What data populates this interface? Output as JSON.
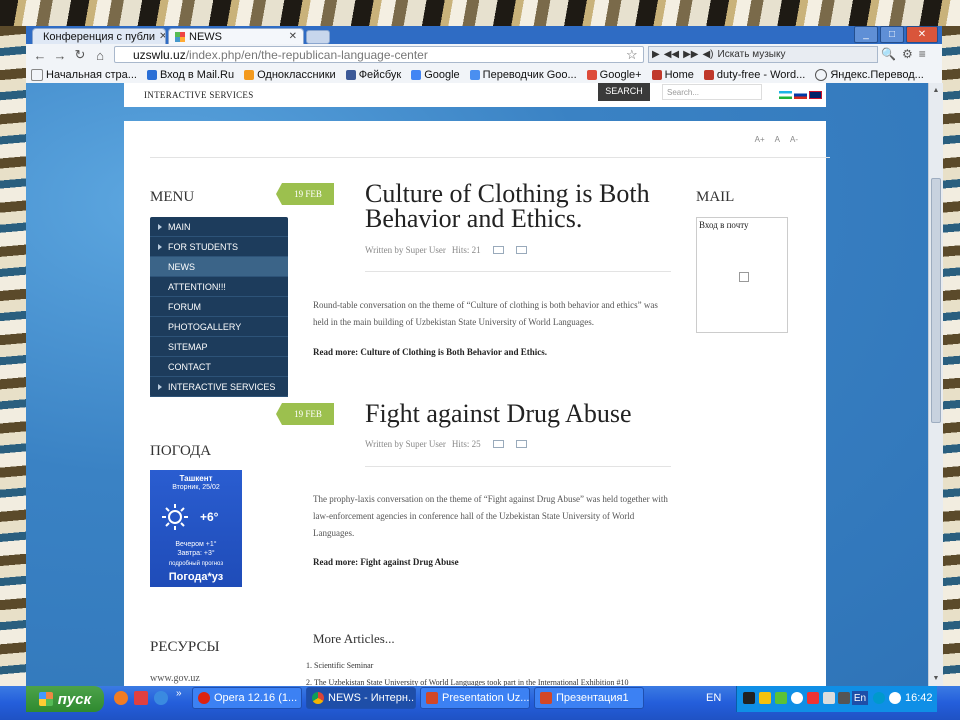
{
  "browser": {
    "tabs": [
      {
        "label": "Конференция с публи",
        "active": false
      },
      {
        "label": "NEWS",
        "active": true
      }
    ],
    "window_buttons": {
      "minimize": "_",
      "maximize": "□",
      "close": "✕"
    },
    "address": {
      "host": "uzswlu.uz",
      "path": "/index.php/en/the-republican-language-center"
    },
    "music_placeholder": "Искать музыку",
    "bookmarks": [
      "Начальная стра...",
      "Вход в Mail.Ru",
      "Одноклассники",
      "Фейсбук",
      "Google",
      "Переводчик Goo...",
      "Google+",
      "Home",
      "duty-free - Word...",
      "Яндекс.Перевод..."
    ]
  },
  "site": {
    "topnav_item": "INTERACTIVE SERVICES",
    "search_button": "SEARCH",
    "search_placeholder": "Search...",
    "font_controls": [
      "A+",
      "A",
      "A-"
    ],
    "menu_title": "MENU",
    "menu": [
      {
        "label": "MAIN",
        "arrow": true,
        "active": false
      },
      {
        "label": "FOR STUDENTS",
        "arrow": true,
        "active": false
      },
      {
        "label": "NEWS",
        "arrow": false,
        "active": true
      },
      {
        "label": "ATTENTION!!!",
        "arrow": false,
        "active": false
      },
      {
        "label": "FORUM",
        "arrow": false,
        "active": false
      },
      {
        "label": "PHOTOGALLERY",
        "arrow": false,
        "active": false
      },
      {
        "label": "SITEMAP",
        "arrow": false,
        "active": false
      },
      {
        "label": "CONTACT",
        "arrow": false,
        "active": false
      },
      {
        "label": "INTERACTIVE SERVICES",
        "arrow": true,
        "active": false
      }
    ],
    "weather_title": "ПОГОДА",
    "weather": {
      "city": "Ташкент",
      "date": "Вторник, 25/02",
      "temp": "+6°",
      "evening": "Вечером +1°",
      "tomorrow": "Завтра: +3°",
      "detail_link": "подробный прогноз",
      "brand": "Погода*уз"
    },
    "resources_title": "РЕСУРСЫ",
    "resources_link": "www.gov.uz",
    "mail_title": "MAIL",
    "mail_link": "Вход в почту",
    "articles": [
      {
        "date": "19 FEB",
        "title": "Culture of Clothing is Both Behavior and Ethics.",
        "author": "Written by Super User",
        "hits": "Hits: 21",
        "body": "Round-table conversation on the theme of “Culture of clothing is both behavior and ethics” was held in the main building of Uzbekistan State University of World Languages.",
        "readmore": "Read more: Culture of Clothing is Both Behavior and Ethics."
      },
      {
        "date": "19 FEB",
        "title": "Fight against Drug Abuse",
        "author": "Written by Super User",
        "hits": "Hits: 25",
        "body": "The prophy-laxis conversation on the theme of “Fight against Drug Abuse” was held together with law-enforcement agencies in conference hall of the Uzbekistan State University of World Languages.",
        "readmore": "Read more: Fight against Drug Abuse"
      }
    ],
    "more_articles_title": "More Articles...",
    "more_articles": [
      "Scientific Seminar",
      "The Uzbekistan State University of World Languages took part in the International Exhibition #10"
    ]
  },
  "taskbar": {
    "start_label": "пуск",
    "tasks": [
      {
        "label": "Opera 12.16 (1...",
        "active": false
      },
      {
        "label": "NEWS - Интерн...",
        "active": true
      },
      {
        "label": "Presentation Uz...",
        "active": false
      },
      {
        "label": "Презентация1",
        "active": false
      }
    ],
    "language": "EN",
    "tray_lang": "En",
    "clock": "16:42"
  },
  "colors": {
    "tab_strip": "#2f6cc4",
    "page_blue": "#3d86c6",
    "menu_bg": "#1d3c5c",
    "date_badge": "#9cc04e",
    "taskbar": "#245edb",
    "start_green": "#2f8a2f"
  }
}
